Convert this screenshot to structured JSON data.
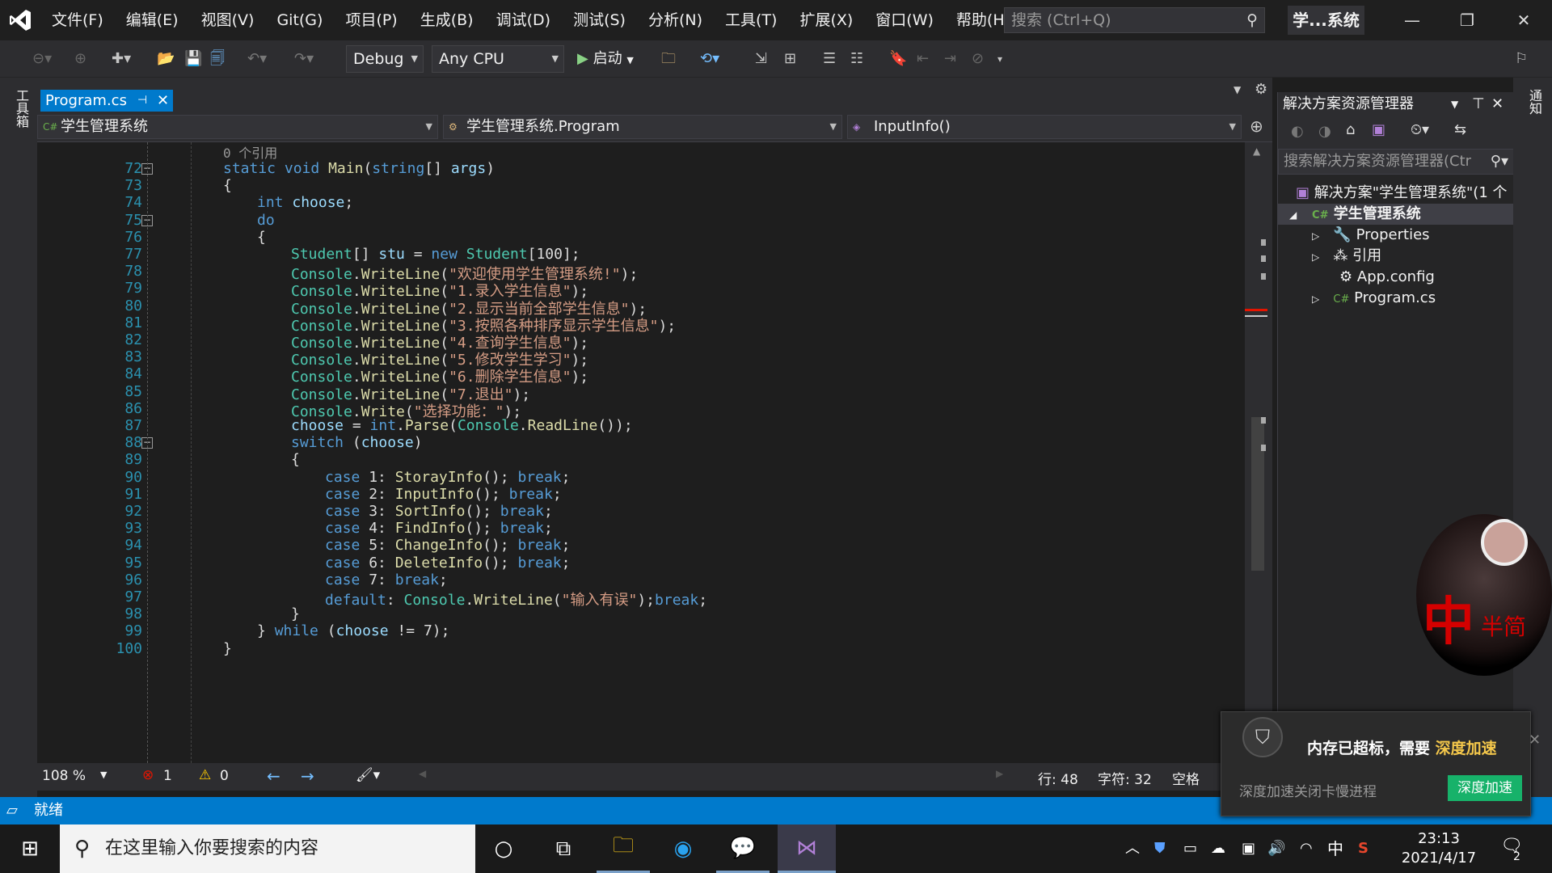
{
  "menu": [
    "文件(F)",
    "编辑(E)",
    "视图(V)",
    "Git(G)",
    "项目(P)",
    "生成(B)",
    "调试(D)",
    "测试(S)",
    "分析(N)",
    "工具(T)",
    "扩展(X)",
    "窗口(W)",
    "帮助(H)"
  ],
  "search_placeholder": "搜索 (Ctrl+Q)",
  "solution_short": "学...系统",
  "toolbar": {
    "config": "Debug",
    "platform": "Any CPU",
    "start": "启动"
  },
  "left_toolbox": "工具箱",
  "right_notify": "通知",
  "tab": {
    "file": "Program.cs"
  },
  "nav": {
    "project": "学生管理系统",
    "class": "学生管理系统.Program",
    "member": "InputInfo()"
  },
  "code": {
    "ref_hint": "0 个引用",
    "lines": [
      {
        "n": "72",
        "t": "static void Main(string[] args)"
      },
      {
        "n": "73",
        "t": "{"
      },
      {
        "n": "74",
        "t": "int choose;"
      },
      {
        "n": "75",
        "t": "do"
      },
      {
        "n": "76",
        "t": "{"
      },
      {
        "n": "77",
        "t": "Student[] stu = new Student[100];"
      },
      {
        "n": "78",
        "t": "Console.WriteLine(\"欢迎使用学生管理系统!\");"
      },
      {
        "n": "79",
        "t": "Console.WriteLine(\"1.录入学生信息\");"
      },
      {
        "n": "80",
        "t": "Console.WriteLine(\"2.显示当前全部学生信息\");"
      },
      {
        "n": "81",
        "t": "Console.WriteLine(\"3.按照各种排序显示学生信息\");"
      },
      {
        "n": "82",
        "t": "Console.WriteLine(\"4.查询学生信息\");"
      },
      {
        "n": "83",
        "t": "Console.WriteLine(\"5.修改学生学习\");"
      },
      {
        "n": "84",
        "t": "Console.WriteLine(\"6.删除学生信息\");"
      },
      {
        "n": "85",
        "t": "Console.WriteLine(\"7.退出\");"
      },
      {
        "n": "86",
        "t": "Console.Write(\"选择功能：\");"
      },
      {
        "n": "87",
        "t": "choose = int.Parse(Console.ReadLine());"
      },
      {
        "n": "88",
        "t": "switch (choose)"
      },
      {
        "n": "89",
        "t": "{"
      },
      {
        "n": "90",
        "t": "case 1: StorayInfo(); break;"
      },
      {
        "n": "91",
        "t": "case 2: InputInfo(); break;"
      },
      {
        "n": "92",
        "t": "case 3: SortInfo(); break;"
      },
      {
        "n": "93",
        "t": "case 4: FindInfo(); break;"
      },
      {
        "n": "94",
        "t": "case 5: ChangeInfo(); break;"
      },
      {
        "n": "95",
        "t": "case 6: DeleteInfo(); break;"
      },
      {
        "n": "96",
        "t": "case 7: break;"
      },
      {
        "n": "97",
        "t": "default: Console.WriteLine(\"输入有误\");break;"
      },
      {
        "n": "98",
        "t": "}"
      },
      {
        "n": "99",
        "t": "} while (choose != 7);"
      },
      {
        "n": "100",
        "t": "}"
      }
    ]
  },
  "editor_status": {
    "zoom": "108 %",
    "errors": "1",
    "warnings": "0",
    "line": "行: 48",
    "col": "字符: 32",
    "ws": "空格"
  },
  "solution_explorer": {
    "title": "解决方案资源管理器",
    "search": "搜索解决方案资源管理器(Ctr",
    "solution": "解决方案\"学生管理系统\"(1 个",
    "project": "学生管理系统",
    "items": [
      "Properties",
      "引用",
      "App.config",
      "Program.cs"
    ]
  },
  "status": {
    "ready": "就绪"
  },
  "taskbar": {
    "search": "在这里输入你要搜索的内容",
    "time": "23:13",
    "date": "2021/4/17",
    "ime": "中",
    "badge": "2"
  },
  "notification": {
    "title_a": "内存已超标，需要",
    "title_b": "深度加速",
    "body": "深度加速关闭卡慢进程",
    "button": "深度加速"
  },
  "avatar_text": {
    "big": "中",
    "small": "半简"
  }
}
